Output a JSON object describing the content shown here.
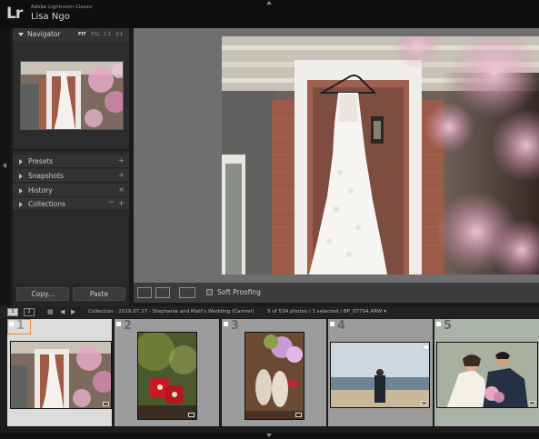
{
  "app": {
    "logo": "Lr",
    "product_name": "Adobe Lightroom Classic",
    "user_name": "Lisa Ngo"
  },
  "navigator": {
    "title": "Navigator",
    "zoom_options": [
      "FIT",
      "FILL",
      "1:1",
      "3:1"
    ],
    "active_zoom": "FIT"
  },
  "panels": [
    {
      "label": "Presets",
      "action": "+"
    },
    {
      "label": "Snapshots",
      "action": "+"
    },
    {
      "label": "History",
      "action": "×"
    },
    {
      "label": "Collections",
      "action": "+",
      "action2": "−"
    }
  ],
  "buttons": {
    "copy": "Copy...",
    "paste": "Paste"
  },
  "toolbar": {
    "soft_proofing": "Soft Proofing"
  },
  "status": {
    "pages": [
      "1",
      "2"
    ],
    "collection": "Collection : 2019.07.27 - Stephanie and Matt's Wedding (Carmel)",
    "count": "5 of 534 photos / 1 selected / BP_07794.ARW ▾"
  },
  "filmstrip": [
    {
      "number": "1",
      "description": "wedding-dress-hanging",
      "selected": true
    },
    {
      "number": "2",
      "description": "red-ring-boxes",
      "selected": false
    },
    {
      "number": "3",
      "description": "bridal-shoes-flowers",
      "selected": false
    },
    {
      "number": "4",
      "description": "groom-on-beach",
      "selected": false
    },
    {
      "number": "5",
      "description": "couple-portrait",
      "selected": false
    }
  ],
  "colors": {
    "selection": "#e88b2e",
    "panel_bg": "#2c2c2c",
    "main_bg": "#6f6f6f"
  }
}
